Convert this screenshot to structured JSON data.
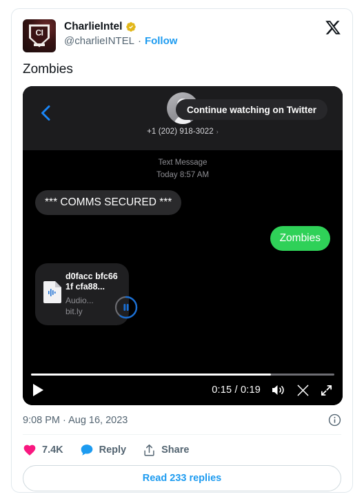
{
  "card": {
    "x_logo_name": "x-logo"
  },
  "author": {
    "display_name": "CharlieIntel",
    "handle": "@charlieINTEL",
    "separator": "·",
    "follow_label": "Follow",
    "verified_badge_color": "#e2b719",
    "avatar_initials": "CI"
  },
  "tweet": {
    "text": "Zombies"
  },
  "video": {
    "continue_pill_label": "Continue watching on Twitter",
    "current_time": "0:15",
    "total_time": "0:19",
    "time_display": "0:15 / 0:19",
    "progress_percent": 79,
    "play_icon": "play-icon",
    "volume_icon": "volume-icon",
    "x_icon": "x-logo-icon",
    "fullscreen_icon": "fullscreen-icon"
  },
  "messages_ui": {
    "back_icon": "back-chevron-icon",
    "contact_phone": "+1 (202) 918-3022",
    "contact_chevron": "›",
    "stamp_line1": "Text Message",
    "stamp_line2": "Today 8:57 AM",
    "bubbles": [
      {
        "direction": "incoming",
        "text": "*** COMMS SECURED ***"
      },
      {
        "direction": "outgoing",
        "text": "Zombies"
      }
    ],
    "attachment": {
      "title": "d0facc bfc661f cfa88...",
      "subtitle": "Audio...",
      "link": "bit.ly",
      "file_icon": "audio-file-icon",
      "pause_icon": "pause-icon"
    }
  },
  "meta": {
    "timestamp": "9:08 PM · Aug 16, 2023",
    "info_icon": "info-icon"
  },
  "engagement": {
    "like_count": "7.4K",
    "like_icon": "heart-icon",
    "like_color": "#f91880",
    "reply_label": "Reply",
    "reply_icon": "reply-icon",
    "reply_color": "#1d9bf0",
    "share_label": "Share",
    "share_icon": "share-icon"
  },
  "footer": {
    "read_replies_label": "Read 233 replies"
  }
}
